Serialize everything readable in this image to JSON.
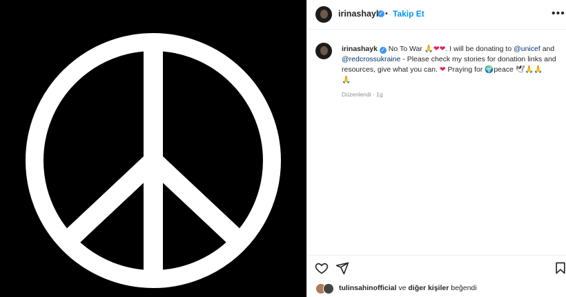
{
  "media": {
    "alt_icon": "peace-sign"
  },
  "header": {
    "username": "irinashayk",
    "verified_icon": "verified-badge",
    "separator": "•",
    "follow_label": "Takip Et",
    "more_icon": "more-options-icon"
  },
  "caption": {
    "username": "irinashayk",
    "text_1": "No To War ",
    "emoji_pray": "🙏",
    "emoji_heart": "❤",
    "text_2": ". I will be donating to ",
    "mention_1": "@unicef",
    "text_3": " and ",
    "mention_2": "@redcrossukraine",
    "text_4": " - Please check my stories for donation links and resources, give what you can. ",
    "text_5": " Praying for ",
    "emoji_globe": "🌍",
    "text_6": "peace ",
    "emoji_dove": "🕊"
  },
  "meta": {
    "edited": "Düzenlendi",
    "sep": " · ",
    "age": "1g"
  },
  "actions": {
    "like_icon": "heart-icon",
    "share_icon": "send-icon",
    "save_icon": "bookmark-icon"
  },
  "likes": {
    "user": "tulinsahinofficial",
    "ve": " ve ",
    "others": "diğer kişiler",
    "suffix": " beğendi"
  },
  "colors": {
    "accent": "#0095f6",
    "heart": "#e0245e",
    "verified": "#3897f0"
  }
}
